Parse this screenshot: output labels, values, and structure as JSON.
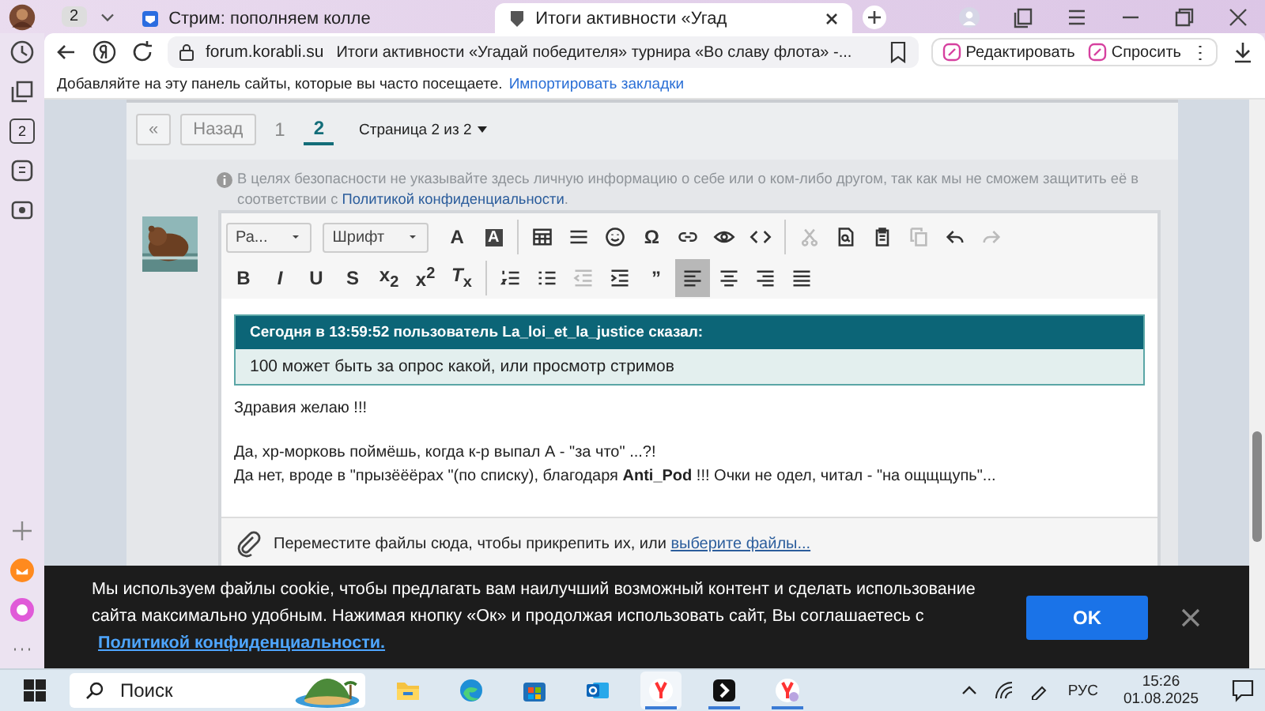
{
  "browser": {
    "tab_count": "2",
    "tabs": [
      {
        "title": "Стрим: пополняем колле",
        "selected": false
      },
      {
        "title": "Итоги активности «Угад",
        "selected": true
      }
    ],
    "url": "forum.korabli.su",
    "page_title": "Итоги активности «Угадай победителя» турнира «Во славу флота» -...",
    "actions": [
      "Редактировать",
      "Спросить"
    ],
    "bookmarks_hint": "Добавляйте на эту панель сайты, которые вы часто посещаете.",
    "bookmarks_link": "Импортировать закладки",
    "sidebar_badge": "2"
  },
  "pagination": {
    "first": "«",
    "prev": "Назад",
    "pages": [
      {
        "label": "1",
        "selected": false
      },
      {
        "label": "2",
        "selected": true
      }
    ],
    "page_menu": "Страница 2 из 2"
  },
  "privacy_note": {
    "text": "В целях безопасности не указывайте здесь личную информацию о себе или о ком-либо другом, так как мы не сможем защитить её в соответствии с",
    "link": "Политикой конфиденциальности",
    "end": "."
  },
  "editor": {
    "toolbar_rows": [
      [
        {
          "kind": "select",
          "label": "Ра...",
          "disabled": false,
          "on": false
        },
        {
          "kind": "select",
          "label": "Шрифт",
          "disabled": false,
          "on": false
        },
        {
          "kind": "glyph",
          "label": "A",
          "disabled": false,
          "on": false
        },
        {
          "kind": "boxed-glyph",
          "label": "A",
          "disabled": false,
          "on": false
        },
        {
          "kind": "table",
          "disabled": false,
          "on": false
        },
        {
          "kind": "rule",
          "disabled": false,
          "on": false
        },
        {
          "kind": "smiley",
          "disabled": false,
          "on": false
        },
        {
          "kind": "glyph",
          "label": "Ω",
          "disabled": false,
          "on": false
        },
        {
          "kind": "link",
          "disabled": false,
          "on": false
        },
        {
          "kind": "eye",
          "disabled": false,
          "on": false
        },
        {
          "kind": "code",
          "disabled": false,
          "on": false
        },
        {
          "kind": "cut",
          "disabled": true,
          "on": false
        },
        {
          "kind": "preview",
          "disabled": false,
          "on": false
        },
        {
          "kind": "paste",
          "disabled": false,
          "on": false
        },
        {
          "kind": "copy",
          "disabled": true,
          "on": false
        },
        {
          "kind": "undo",
          "disabled": false,
          "on": false
        },
        {
          "kind": "redo",
          "disabled": true,
          "on": false
        }
      ],
      [
        {
          "kind": "glyph",
          "label": "B",
          "disabled": false,
          "on": false
        },
        {
          "kind": "glyph",
          "label": "*I*",
          "disabled": false,
          "on": false
        },
        {
          "kind": "glyph",
          "label": "U",
          "disabled": false,
          "on": false
        },
        {
          "kind": "glyph",
          "label": "S",
          "disabled": false,
          "on": false
        },
        {
          "kind": "glyph",
          "label": "x$_{2}$",
          "disabled": false,
          "on": false
        },
        {
          "kind": "glyph",
          "label": "x$^{2}$",
          "disabled": false,
          "on": false
        },
        {
          "kind": "glyph",
          "label": "*T*$_{x}$",
          "disabled": false,
          "on": false
        },
        {
          "kind": "ordered-list",
          "disabled": false,
          "on": false
        },
        {
          "kind": "bullet-list",
          "disabled": false,
          "on": false
        },
        {
          "kind": "outdent",
          "disabled": true,
          "on": false
        },
        {
          "kind": "indent",
          "disabled": false,
          "on": false
        },
        {
          "kind": "glyph",
          "label": "”",
          "disabled": false,
          "on": false
        },
        {
          "kind": "align-left",
          "disabled": false,
          "on": true
        },
        {
          "kind": "align-center",
          "disabled": false,
          "on": false
        },
        {
          "kind": "align-right",
          "disabled": false,
          "on": false
        },
        {
          "kind": "align-justify",
          "disabled": false,
          "on": false
        }
      ]
    ],
    "quote": {
      "header": "Сегодня в 13:59:52 пользователь La_loi_et_la_justice сказал:",
      "text": "100 может быть за опрос какой, или просмотр стримов"
    },
    "blocks": [
      {
        "lines": [
          "Здравия желаю !!!"
        ]
      },
      {
        "lines": [
          "Да, хр-морковь поймёшь, когда к-р выпал А  - \"за что\" ...?!",
          "Да нет, вроде в \"прызёёёрах \"(по списку), благодаря **Anti_Pod** !!! Очки не одел, читал - \"на ощщщупь\"..."
        ]
      }
    ],
    "attach": {
      "text": "Переместите файлы сюда, чтобы прикрепить их, или",
      "link": "выберите файлы..."
    }
  },
  "cookie": {
    "text": "Мы используем файлы cookie, чтобы предлагать вам наилучший возможный контент и сделать использование сайта максимально удобным. Нажимая кнопку «Ок» и продолжая использовать сайт, Вы соглашаетесь с",
    "link": "Политикой конфиденциальности.",
    "button": "OK"
  },
  "taskbar": {
    "search_placeholder": "Поиск",
    "apps": [
      {
        "kind": "folder",
        "running": false,
        "selected": false
      },
      {
        "kind": "edge",
        "running": false,
        "selected": false
      },
      {
        "kind": "store",
        "running": false,
        "selected": false
      },
      {
        "kind": "outlook",
        "running": false,
        "selected": false
      },
      {
        "kind": "yandex",
        "running": true,
        "selected": true
      },
      {
        "kind": "terminal",
        "running": true,
        "selected": false
      },
      {
        "kind": "yandex-profile",
        "running": true,
        "selected": false
      }
    ],
    "language": "РУС",
    "time": "15:26",
    "date": "01.08.2025"
  }
}
